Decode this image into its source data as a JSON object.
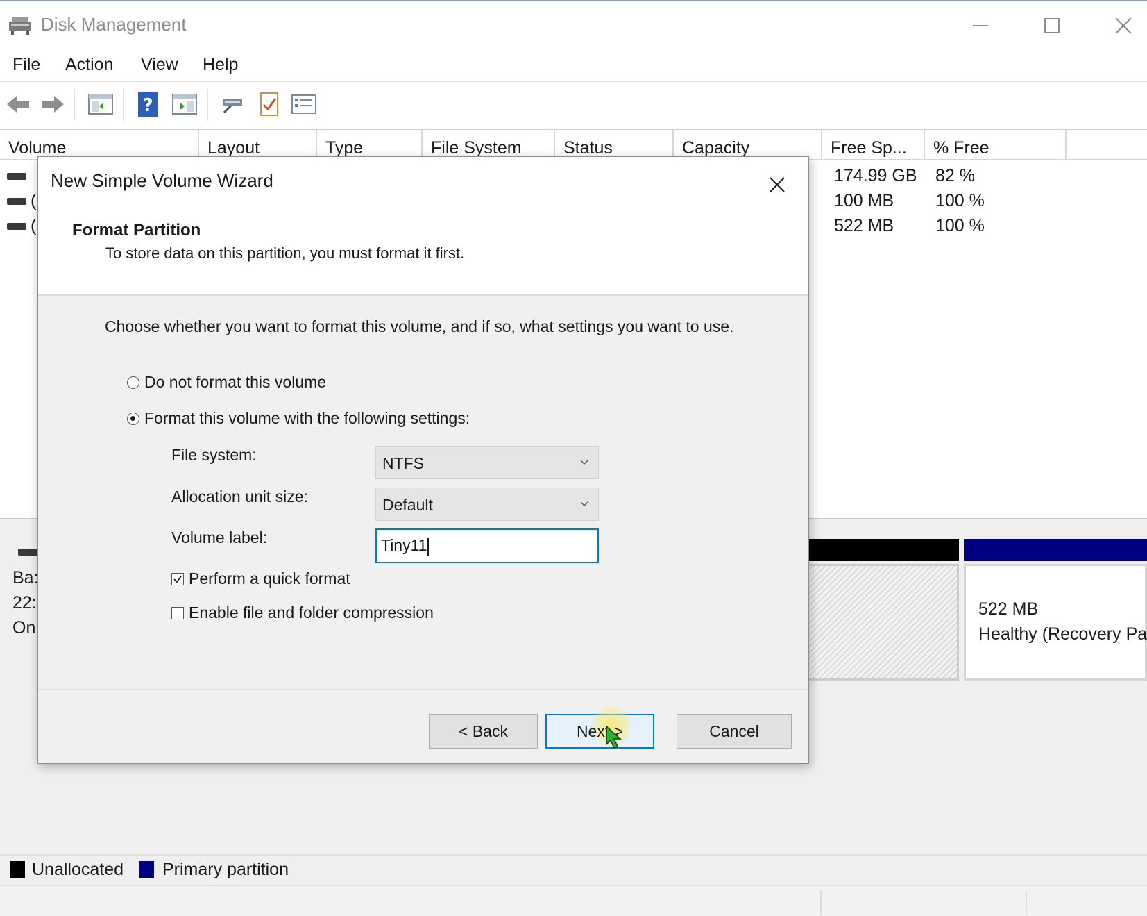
{
  "window": {
    "title": "Disk Management",
    "icon": "disk-management-icon"
  },
  "menu": [
    "File",
    "Action",
    "View",
    "Help"
  ],
  "toolbar": {
    "icons": [
      "back-arrow-icon",
      "forward-arrow-icon",
      "console-tree-icon",
      "help-icon",
      "action-pane-icon",
      "connect-icon",
      "properties-icon",
      "list-view-icon"
    ]
  },
  "volume_list": {
    "columns": [
      "Volume",
      "Layout",
      "Type",
      "File System",
      "Status",
      "Capacity",
      "Free Sp...",
      "% Free"
    ],
    "rows": [
      {
        "volume": "",
        "free_space": "174.99 GB",
        "percent_free": "82 %"
      },
      {
        "volume": "(",
        "free_space": "100 MB",
        "percent_free": "100 %"
      },
      {
        "volume": "(",
        "free_space": "522 MB",
        "percent_free": "100 %"
      }
    ]
  },
  "graphical_view": {
    "disk_info": [
      "Ba:",
      "22:",
      "On"
    ],
    "recovery_partition": {
      "size": "522 MB",
      "status": "Healthy (Recovery Pa"
    }
  },
  "legend": [
    {
      "label": "Unallocated",
      "color": "#000000"
    },
    {
      "label": "Primary partition",
      "color": "#000080"
    }
  ],
  "dialog": {
    "title": "New Simple Volume Wizard",
    "heading": "Format Partition",
    "subheading": "To store data on this partition, you must format it first.",
    "instruction": "Choose whether you want to format this volume, and if so, what settings you want to use.",
    "options": {
      "no_format": "Do not format this volume",
      "format": "Format this volume with the following settings:"
    },
    "selected_option": "format",
    "file_system": {
      "label": "File system:",
      "value": "NTFS"
    },
    "allocation_unit": {
      "label": "Allocation unit size:",
      "value": "Default"
    },
    "volume_label": {
      "label": "Volume label:",
      "value": "Tiny11"
    },
    "quick_format": {
      "label": "Perform a quick format",
      "checked": true
    },
    "compression": {
      "label": "Enable file and folder compression",
      "checked": false
    },
    "buttons": {
      "back": "< Back",
      "next": "Next >",
      "cancel": "Cancel"
    }
  },
  "colors": {
    "accent": "#0078d7",
    "unallocated": "#000000",
    "primary_partition": "#000080"
  }
}
